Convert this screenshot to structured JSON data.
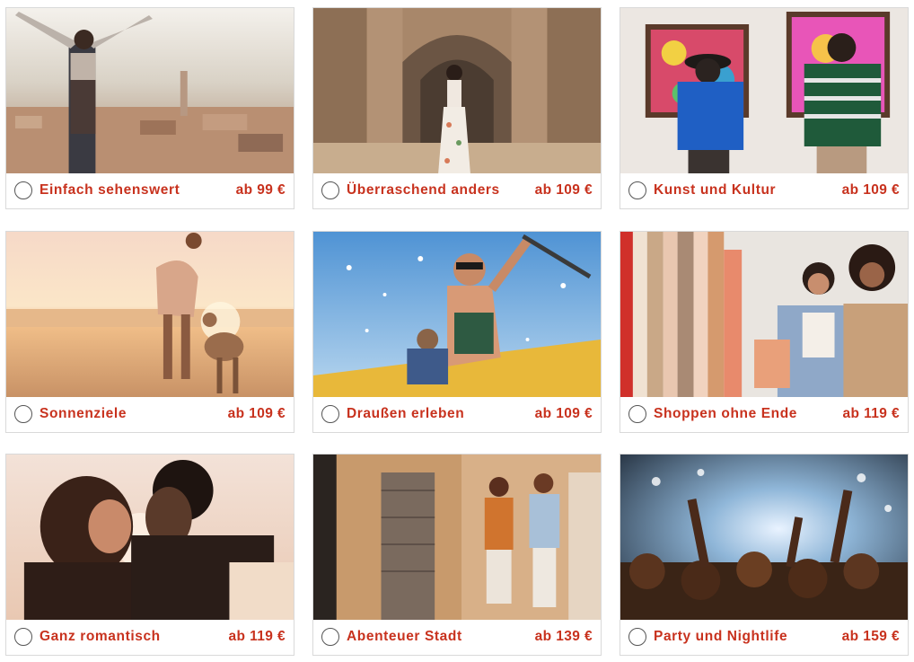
{
  "cards": [
    {
      "label": "Einfach sehenswert",
      "price": "ab 99 €"
    },
    {
      "label": "Überraschend anders",
      "price": "ab 109 €"
    },
    {
      "label": "Kunst und Kultur",
      "price": "ab 109 €"
    },
    {
      "label": "Sonnenziele",
      "price": "ab 109 €"
    },
    {
      "label": "Draußen erleben",
      "price": "ab 109 €"
    },
    {
      "label": "Shoppen ohne Ende",
      "price": "ab 119 €"
    },
    {
      "label": "Ganz romantisch",
      "price": "ab 119 €"
    },
    {
      "label": "Abenteuer Stadt",
      "price": "ab 139 €"
    },
    {
      "label": "Party und Nightlife",
      "price": "ab 159 €"
    }
  ],
  "colors": {
    "accent": "#c8321e",
    "border": "#d9d9d9"
  }
}
